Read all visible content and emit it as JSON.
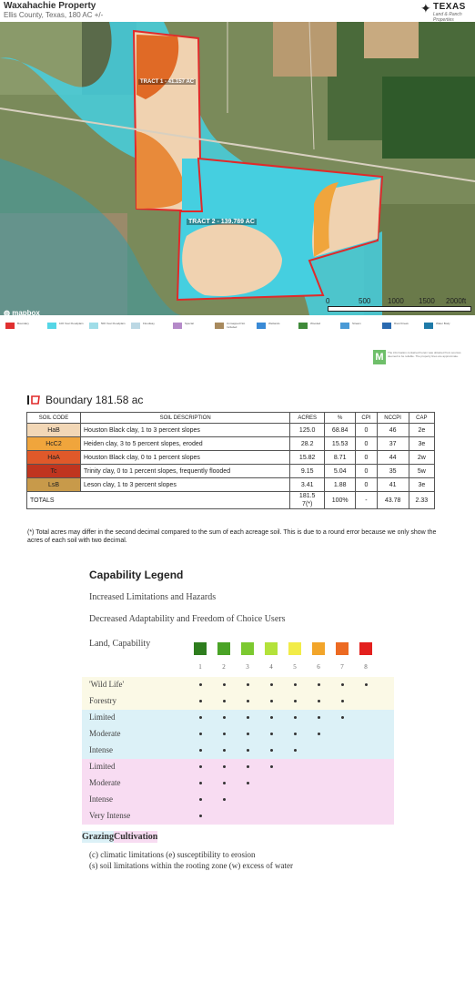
{
  "header": {
    "title": "Waxahachie Property",
    "subtitle": "Ellis County, Texas, 180 AC +/-",
    "logo_main": "TEXAS",
    "logo_sub": "Land & Ranch Properties"
  },
  "map": {
    "tract1_label": "TRACT 1 - 41.157 AC",
    "tract2_label": "TRACT 2 - 139.789 AC",
    "attribution": "mapbox",
    "scale_labels": [
      "0",
      "500",
      "1000",
      "1500",
      "2000ft"
    ]
  },
  "legend_strip": {
    "items": [
      {
        "label": "Boundary",
        "color": "#e03030"
      },
      {
        "label": "100 Year Floodplain",
        "color": "#55d6e6"
      },
      {
        "label": "500 Year Floodplain",
        "color": "#9fdde8"
      },
      {
        "label": "Floodway",
        "color": "#bcd8e4"
      },
      {
        "label": "Special",
        "color": "#b58ac9"
      },
      {
        "label": "Unmapped Not Included",
        "color": "#a88a5e"
      },
      {
        "label": "Wetlands",
        "color": "#3a8ad6"
      },
      {
        "label": "Wooded",
        "color": "#3f8a3a"
      },
      {
        "label": "Stream",
        "color": "#4a9ad6"
      },
      {
        "label": "River/Creek",
        "color": "#2a6ab0"
      },
      {
        "label": "Water Body",
        "color": "#1f7aa8"
      }
    ]
  },
  "disclaimer": "The information contained herein was obtained from sources deemed to be reliable. The property lines are approximate.",
  "boundary": {
    "title": "Boundary 181.58 ac",
    "columns": [
      "SOIL CODE",
      "SOIL DESCRIPTION",
      "ACRES",
      "%",
      "CPI",
      "NCCPI",
      "CAP"
    ],
    "rows": [
      {
        "code": "HaB",
        "color": "#f2d7b6",
        "desc": "Houston Black clay, 1 to 3 percent slopes",
        "acres": "125.0",
        "pct": "68.84",
        "cpi": "0",
        "nccpi": "46",
        "cap": "2e"
      },
      {
        "code": "HcC2",
        "color": "#f0a53c",
        "desc": "Heiden clay, 3 to 5 percent slopes, eroded",
        "acres": "28.2",
        "pct": "15.53",
        "cpi": "0",
        "nccpi": "37",
        "cap": "3e"
      },
      {
        "code": "HaA",
        "color": "#e0592a",
        "desc": "Houston Black clay, 0 to 1 percent slopes",
        "acres": "15.82",
        "pct": "8.71",
        "cpi": "0",
        "nccpi": "44",
        "cap": "2w"
      },
      {
        "code": "Tc",
        "color": "#c0351f",
        "desc": "Trinity clay, 0 to 1 percent slopes, frequently flooded",
        "acres": "9.15",
        "pct": "5.04",
        "cpi": "0",
        "nccpi": "35",
        "cap": "5w"
      },
      {
        "code": "LsB",
        "color": "#c89a4a",
        "desc": "Leson clay, 1 to 3 percent slopes",
        "acres": "3.41",
        "pct": "1.88",
        "cpi": "0",
        "nccpi": "41",
        "cap": "3e"
      }
    ],
    "totals": {
      "label": "TOTALS",
      "acres": "181.5\n7(*)",
      "pct": "100%",
      "cpi": "-",
      "nccpi": "43.78",
      "cap": "2.33"
    },
    "footnote": "(*) Total acres may differ in the second decimal compared to the sum of each acreage soil. This is due to a round error because we only show the acres of each soil with two decimal."
  },
  "capability": {
    "title": "Capability Legend",
    "line1": "Increased Limitations and Hazards",
    "line2": "Decreased Adaptability and Freedom of Choice Users",
    "line3": "Land, Capability",
    "class_colors": [
      "#2e7d1e",
      "#4aa326",
      "#7cc930",
      "#b3e23a",
      "#f2ec48",
      "#f2a52a",
      "#ec6a22",
      "#e3201e"
    ],
    "class_numbers": [
      "1",
      "2",
      "3",
      "4",
      "5",
      "6",
      "7",
      "8"
    ],
    "rows": [
      {
        "label": "'Wild Life'",
        "n": 8,
        "bg": "#fbf9e6"
      },
      {
        "label": "Forestry",
        "n": 7,
        "bg": "#fbf9e6"
      },
      {
        "label": "Limited",
        "n": 7,
        "bg": "#dcf1f7"
      },
      {
        "label": "Moderate",
        "n": 6,
        "bg": "#dcf1f7"
      },
      {
        "label": "Intense",
        "n": 5,
        "bg": "#dcf1f7"
      },
      {
        "label": "Limited",
        "n": 4,
        "bg": "#f8dcf2"
      },
      {
        "label": "Moderate",
        "n": 3,
        "bg": "#f8dcf2"
      },
      {
        "label": "Intense",
        "n": 2,
        "bg": "#f8dcf2"
      },
      {
        "label": "Very Intense",
        "n": 1,
        "bg": "#f8dcf2"
      }
    ],
    "grazing": "Grazing",
    "cultivation": "Cultivation",
    "note1": "(c) climatic limitations (e) susceptibility to erosion",
    "note2": "(s) soil limitations within the rooting zone (w) excess of water"
  }
}
